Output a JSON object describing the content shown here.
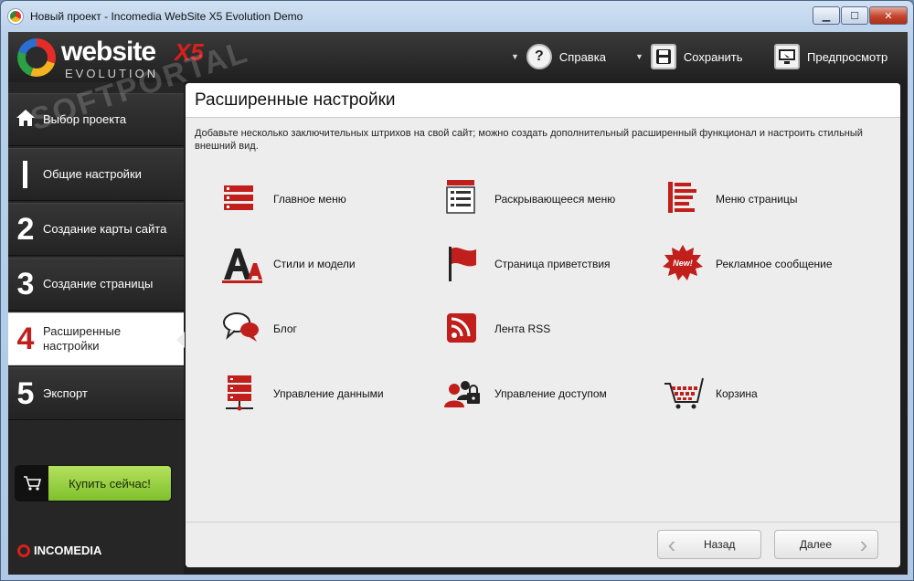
{
  "window": {
    "title": "Новый проект - Incomedia WebSite X5 Evolution Demo"
  },
  "logo": {
    "main": "website",
    "x5": "X5",
    "sub": "EVOLUTION"
  },
  "toolbar": {
    "help": {
      "label": "Справка",
      "icon": "question-icon"
    },
    "save": {
      "label": "Сохранить",
      "icon": "floppy-icon"
    },
    "preview": {
      "label": "Предпросмотр",
      "icon": "monitor-icon"
    }
  },
  "sidebar": {
    "steps": [
      {
        "num": "⌂",
        "label": "Выбор проекта"
      },
      {
        "num": "1",
        "label": "Общие настройки"
      },
      {
        "num": "2",
        "label": "Создание карты сайта"
      },
      {
        "num": "3",
        "label": "Создание страницы"
      },
      {
        "num": "4",
        "label": "Расширенные настройки"
      },
      {
        "num": "5",
        "label": "Экспорт"
      }
    ],
    "buy_label": "Купить сейчас!",
    "brand": "INCOMEDIA"
  },
  "panel": {
    "title": "Расширенные настройки",
    "description": "Добавьте несколько заключительных штрихов на свой сайт; можно создать дополнительный расширенный функционал и настроить стильный внешний вид.",
    "items": [
      {
        "label": "Главное меню",
        "icon": "main-menu-icon"
      },
      {
        "label": "Раскрывающееся меню",
        "icon": "dropdown-menu-icon"
      },
      {
        "label": "Меню страницы",
        "icon": "page-menu-icon"
      },
      {
        "label": "Стили и модели",
        "icon": "styles-icon"
      },
      {
        "label": "Страница приветствия",
        "icon": "flag-icon"
      },
      {
        "label": "Рекламное сообщение",
        "icon": "new-badge-icon"
      },
      {
        "label": "Блог",
        "icon": "blog-bubbles-icon"
      },
      {
        "label": "Лента RSS",
        "icon": "rss-icon"
      },
      {
        "label": "Управление данными",
        "icon": "database-icon"
      },
      {
        "label": "Управление доступом",
        "icon": "access-users-icon"
      },
      {
        "label": "Корзина",
        "icon": "cart-icon"
      }
    ],
    "badge_new": "New!",
    "back_label": "Назад",
    "next_label": "Далее"
  },
  "watermark": "SOFTPORTAL",
  "colors": {
    "accent": "#c01f1b",
    "buy": "#8fcb3a",
    "dark": "#1e1e1e"
  }
}
